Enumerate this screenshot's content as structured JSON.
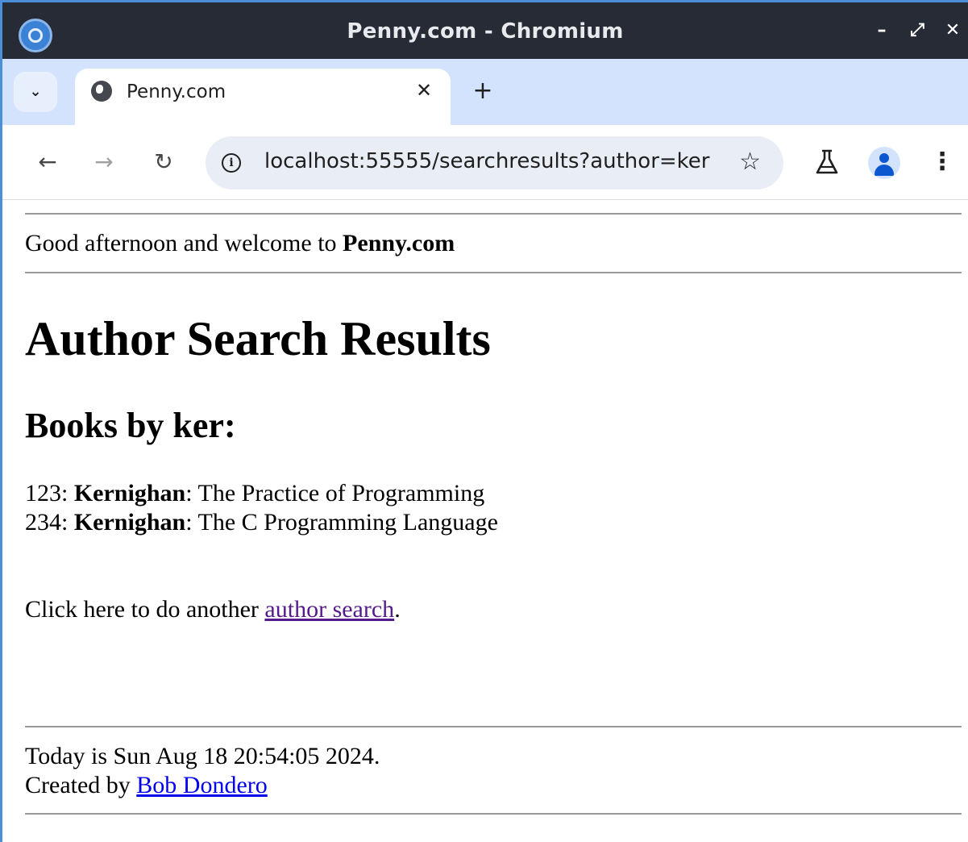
{
  "window": {
    "title": "Penny.com - Chromium",
    "controls": {
      "minimize": "–",
      "restore": "⤢",
      "close": "✕"
    }
  },
  "tabs": [
    {
      "title": "Penny.com",
      "icon": "globe-icon",
      "active": true
    }
  ],
  "tabstrip": {
    "tab_list_glyph": "⌄",
    "close_glyph": "✕",
    "new_tab_glyph": "+"
  },
  "toolbar": {
    "back_glyph": "←",
    "forward_glyph": "→",
    "reload_glyph": "↻",
    "url": "localhost:55555/searchresults?author=ker",
    "star_glyph": "☆",
    "menu_glyph": "⋮"
  },
  "page": {
    "greeting_prefix": "Good afternoon and welcome to ",
    "site_name": "Penny.com",
    "heading": "Author Search Results",
    "subheading": "Books by ker:",
    "results": [
      {
        "isbn": "123",
        "author": "Kernighan",
        "title": "The Practice of Programming"
      },
      {
        "isbn": "234",
        "author": "Kernighan",
        "title": "The C Programming Language"
      }
    ],
    "again_prefix": "Click here to do another ",
    "again_link": "author search",
    "again_suffix": ".",
    "today_text": "Today is Sun Aug 18 20:54:05 2024.",
    "created_prefix": "Created by ",
    "creator_link": "Bob Dondero"
  },
  "colors": {
    "titlebar": "#262b35",
    "tabstrip": "#d3e3fd",
    "omnibox": "#e9eef6",
    "link": "#0000ee",
    "visited_link": "#551a8b"
  }
}
